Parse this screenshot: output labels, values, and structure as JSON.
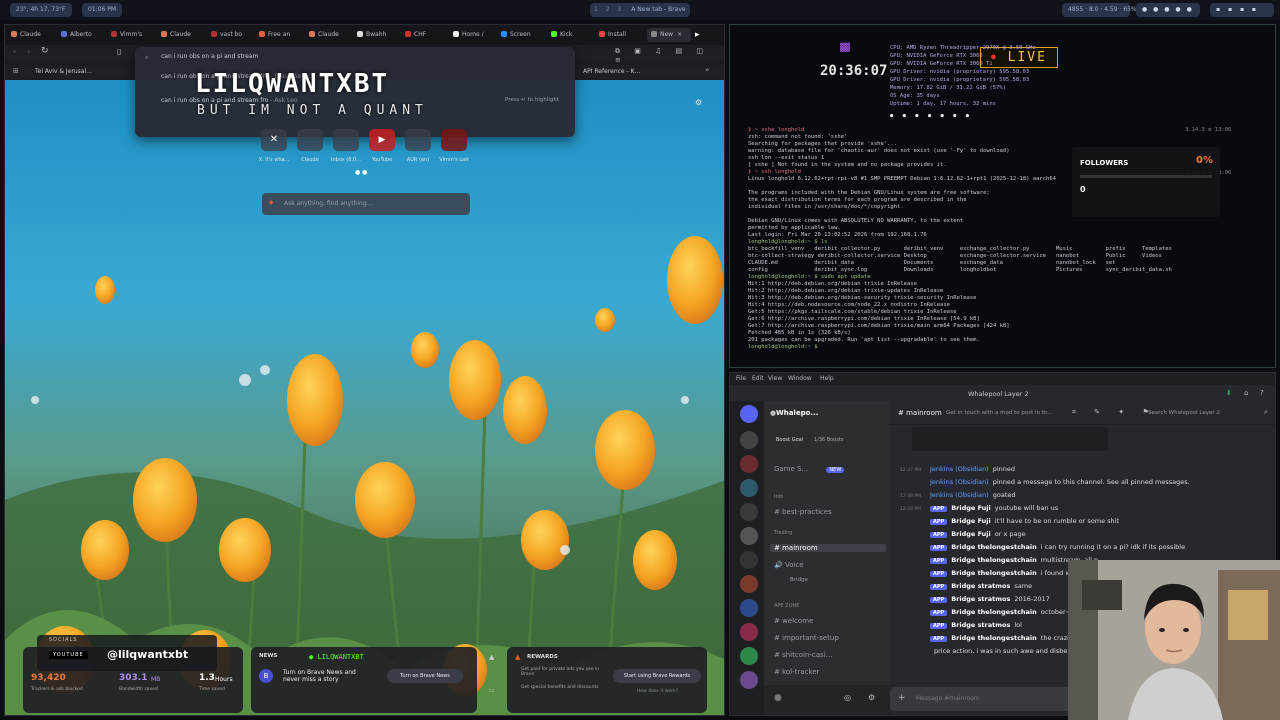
{
  "sysbar": {
    "left_pills": [
      "23°, 4h 17, 73°F",
      "01:06 PM"
    ],
    "workspaces": [
      "1",
      "2",
      "3"
    ],
    "active_title": "A New tab - Brave",
    "right_pills": [
      "4855 · 8.0 · 4.59 · 65%",
      "",
      ""
    ]
  },
  "browser": {
    "tabs": [
      {
        "label": "Claude",
        "color": "#d97757"
      },
      {
        "label": "Alberto",
        "color": "#5a6fd6"
      },
      {
        "label": "Vimm's",
        "color": "#a33"
      },
      {
        "label": "Claude",
        "color": "#d97757"
      },
      {
        "label": "vast bo",
        "color": "#a33"
      },
      {
        "label": "Free an",
        "color": "#e0603b"
      },
      {
        "label": "Claude",
        "color": "#d97757"
      },
      {
        "label": "Bwahh",
        "color": "#ddd"
      },
      {
        "label": "CHF",
        "color": "#c33"
      },
      {
        "label": "Home /",
        "color": "#eee"
      },
      {
        "label": "Screen",
        "color": "#2b8cff"
      },
      {
        "label": "Kick",
        "color": "#53fc18"
      },
      {
        "label": "Install",
        "color": "#e44"
      },
      {
        "label": "New",
        "color": "#888"
      }
    ],
    "address": "can i run obs on a pi and stream",
    "bookmarks": [
      "Tel Aviv & Jerusal...",
      "API Reference - K..."
    ],
    "search_suggestions": [
      {
        "text": "can i run obs on a pi and stream fro",
        "source": "- Brave Search"
      },
      {
        "text": "can i run obs on a pi and stream fro",
        "source": "- Ask Leo",
        "hint": "Press ↵ to highlight"
      }
    ],
    "shortcuts": [
      "X. It's wha...",
      "Claude",
      "Inbox (6,0...",
      "YouTube",
      "AUR (en)",
      "Vimm's Lair"
    ],
    "ask_placeholder": "Ask anything, find anything...",
    "stats": {
      "trackers": "93,420",
      "trackers_label": "Trackers & ads blocked",
      "bandwidth": "303.1",
      "bandwidth_unit": "MB",
      "bandwidth_label": "Bandwidth saved",
      "time": "1.3",
      "time_unit": "Hours",
      "time_label": "Time saved"
    },
    "news": {
      "title": "NEWS",
      "body": "Turn on Brave News and never miss a story",
      "button": "Turn on Brave News"
    },
    "rewards": {
      "title": "REWARDS",
      "line1": "Get paid for private ads you see in Brave",
      "line2": "Get special benefits and discounts",
      "button": "Start using Brave Rewards",
      "link": "How does it work?"
    }
  },
  "overlay": {
    "channel_name": "LILQWANTXBT",
    "tagline": "BUT IM NOT A QUANT",
    "socials_label": "SOCIALS",
    "platform": "YOUTUBE",
    "handle": "@lilqwantxbt",
    "ticker": "● LILQWANTXBT",
    "clock": "20:36:07",
    "live": "LIVE",
    "followers_label": "FOLLOWERS",
    "followers_count": "0",
    "followers_pct": "0%"
  },
  "terminal": {
    "sysinfo": [
      "CPU: AMD Ryzen Threadripper 2970X @ 3.50 GHz",
      "GPU: NVIDIA GeForce RTX 3060",
      "GPU: NVIDIA GeForce RTX 3060 Ti",
      "GPU Driver: nvidia (proprietary) 595.58.03",
      "GPU Driver: nvidia (proprietary) 595.58.03",
      "Memory: 17.82 GiB / 31.22 GiB (57%)",
      "OS Age: 35 days",
      "Uptime: 1 day, 17 hours, 32 mins"
    ],
    "prompt_time": "3.14.3 ≡ 13:06",
    "lines": [
      "❯ ~ sshe longhold",
      "zsh: command not found: 'sshe'",
      "Searching for packages that provide 'sshe'...",
      "warning: database file for 'chaotic-aur' does not exist (use '-Fy' to download)",
      "ssh lon --exit status 1",
      "[ sshe ] Not found in the system and no package provides it.",
      "❯ ~ ssh longhold",
      "Linux longhold 6.12.62+rpt-rpi-v8 #1 SMP PREEMPT Debian 1:6.12.62-1+rpt1 (2025-12-18) aarch64",
      "",
      "The programs included with the Debian GNU/Linux system are free software;",
      "the exact distribution terms for each program are described in the",
      "individual files in /usr/share/doc/*/copyright.",
      "",
      "Debian GNU/Linux comes with ABSOLUTELY NO WARRANTY, to the extent",
      "permitted by applicable law.",
      "Last login: Fri Mar 20 13:02:52 2026 from 192.168.1.76",
      "longhold@longhold:~ $ ls",
      "btc_backfill_venv   deribit_collector.py       deribit_venv     exchange_collector.py        Music          prefix     Templates",
      "btc-collect-strategy deribit-collector.service Desktop          exchange-collector.service   nanobot        Public     Videos",
      "CLAUDE.md           deribit_data               Documents        exchange_data                nanobot_lock   set",
      "config              deribit_sync.log           Downloads        longholdbot                  Pictures       sync_deribit_data.sh",
      "longhold@longhold:~ $ sudo apt update",
      "Hit:1 http://deb.debian.org/debian trixie InRelease",
      "Hit:2 http://deb.debian.org/debian trixie-updates InRelease",
      "Hit:3 http://deb.debian.org/debian-security trixie-security InRelease",
      "Hit:4 https://deb.nodesource.com/node_22.x nodistro InRelease",
      "Get:5 https://pkgs.tailscale.com/stable/debian trixie InRelease",
      "Get:6 http://archive.raspberrypi.com/debian trixie InRelease [54.9 kB]",
      "Get:7 http://archive.raspberrypi.com/debian trixie/main arm64 Packages [424 kB]",
      "Fetched 485 kB in 1s (326 kB/s)",
      "201 packages can be upgraded. Run 'apt list --upgradable' to see them.",
      "longhold@longhold:~ $ "
    ]
  },
  "discord": {
    "menu": [
      "File",
      "Edit",
      "View",
      "Window",
      "Help"
    ],
    "window_title": "Whalepool Layer 2",
    "server_name": "Whalepo...",
    "channel": "mainroom",
    "topic": "Get in touch with a mod to post in th...",
    "search": "Search Whalepool Layer 2",
    "boost": "Boost Goal",
    "boost_count": "1/36 Boosts",
    "sidebar": [
      {
        "label": "Game S...",
        "badge": "NEW"
      },
      {
        "label": "Info"
      },
      {
        "label": "best-practices"
      },
      {
        "label": "Trading"
      },
      {
        "label": "mainroom"
      },
      {
        "label": "Voice"
      },
      {
        "label": "Bridge"
      },
      {
        "label": "APE ZONE"
      },
      {
        "label": "welcome"
      },
      {
        "label": "important-setup"
      },
      {
        "label": "shitcoin-casi..."
      },
      {
        "label": "kol-tracker"
      }
    ],
    "messages": [
      {
        "time": "12:47 PM",
        "author": "Jenkins (Obsidian)",
        "text": "pinned"
      },
      {
        "time": "",
        "author": "Jenkins (Obsidian)",
        "text": "pinned a message to this channel. See all pinned messages."
      },
      {
        "time": "12:48 PM",
        "author": "Jenkins (Obsidian)",
        "text": "goated"
      },
      {
        "time": "12:50 PM",
        "author": "Bridge Fuji",
        "text": "youtube will ban us"
      },
      {
        "time": "",
        "author": "Bridge Fuji",
        "text": "it'll have to be on rumble or some shit"
      },
      {
        "time": "",
        "author": "Bridge Fuji",
        "text": "or x page"
      },
      {
        "time": "",
        "author": "Bridge thelongestchain",
        "text": "i can try running it on a pi? idk if its possible"
      },
      {
        "time": "",
        "author": "Bridge thelongestchain",
        "text": "multistream, all p..."
      },
      {
        "time": "",
        "author": "Bridge thelongestchain",
        "text": "i found wp from y..."
      },
      {
        "time": "",
        "author": "Bridge stratmos",
        "text": "same"
      },
      {
        "time": "",
        "author": "Bridge stratmos",
        "text": "2016-2017"
      },
      {
        "time": "",
        "author": "Bridge thelongestchain",
        "text": "october~ rsh mart..."
      },
      {
        "time": "",
        "author": "Bridge stratmos",
        "text": "lol"
      },
      {
        "time": "",
        "author": "Bridge thelongestchain",
        "text": "the craziest part, ..."
      },
      {
        "time": "",
        "author": "",
        "text": "price action, i was in such awe and disbelief"
      }
    ],
    "input_placeholder": "Message #mainroom"
  }
}
